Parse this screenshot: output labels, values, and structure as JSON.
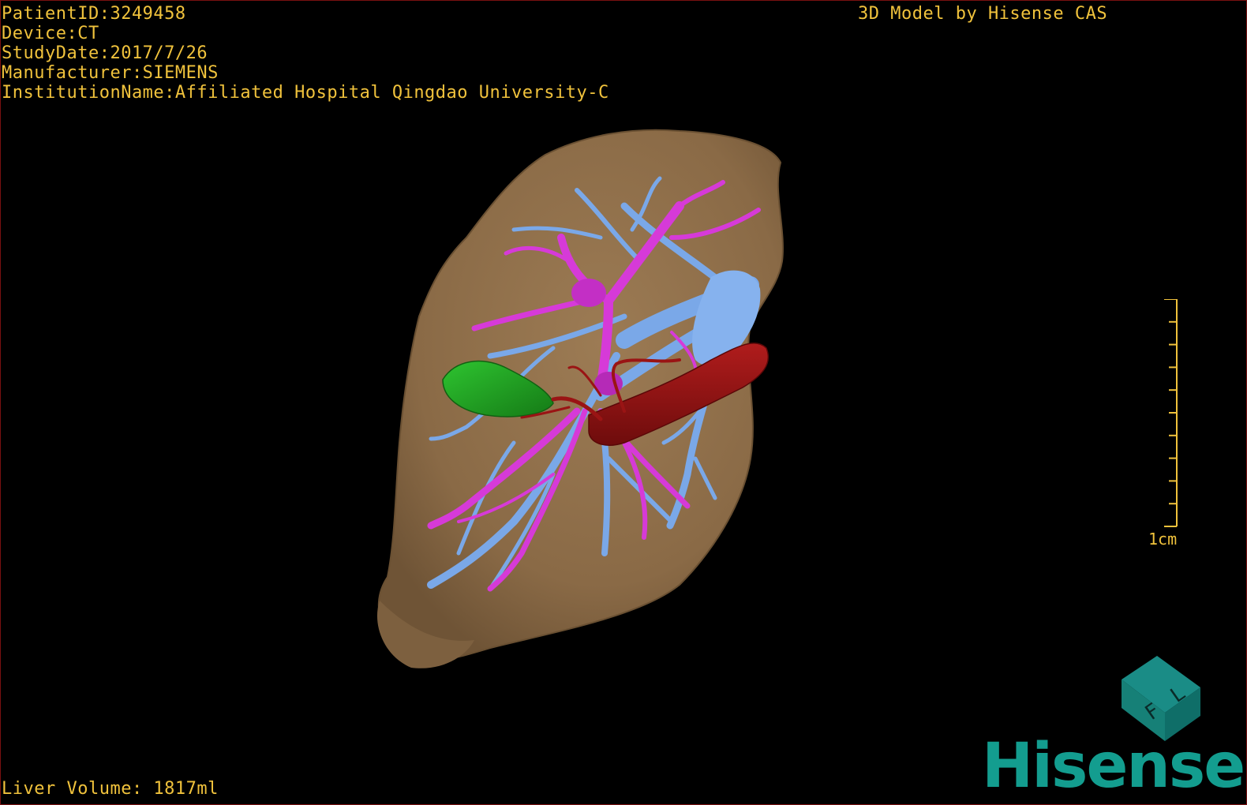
{
  "overlay": {
    "patient_id": "PatientID:3249458",
    "device": "Device:CT",
    "study_date": "StudyDate:2017/7/26",
    "manufacturer": "Manufacturer:SIEMENS",
    "institution": "InstitutionName:Affiliated Hospital Qingdao University-C",
    "model_title": "3D Model by Hisense CAS",
    "liver_volume": "Liver Volume: 1817ml"
  },
  "scale_bar": {
    "label": "1cm",
    "ticks": 11
  },
  "brand": {
    "name": "Hisense",
    "cube_letters": [
      "F",
      "L"
    ]
  },
  "colors": {
    "overlay_text": "#f0c23c",
    "liver": "#8c6c48",
    "hepatic_vein": "#7aa8e8",
    "portal_vein": "#d63ad8",
    "artery": "#8a1212",
    "gallbladder": "#1ea320",
    "brand": "#139d8f"
  }
}
